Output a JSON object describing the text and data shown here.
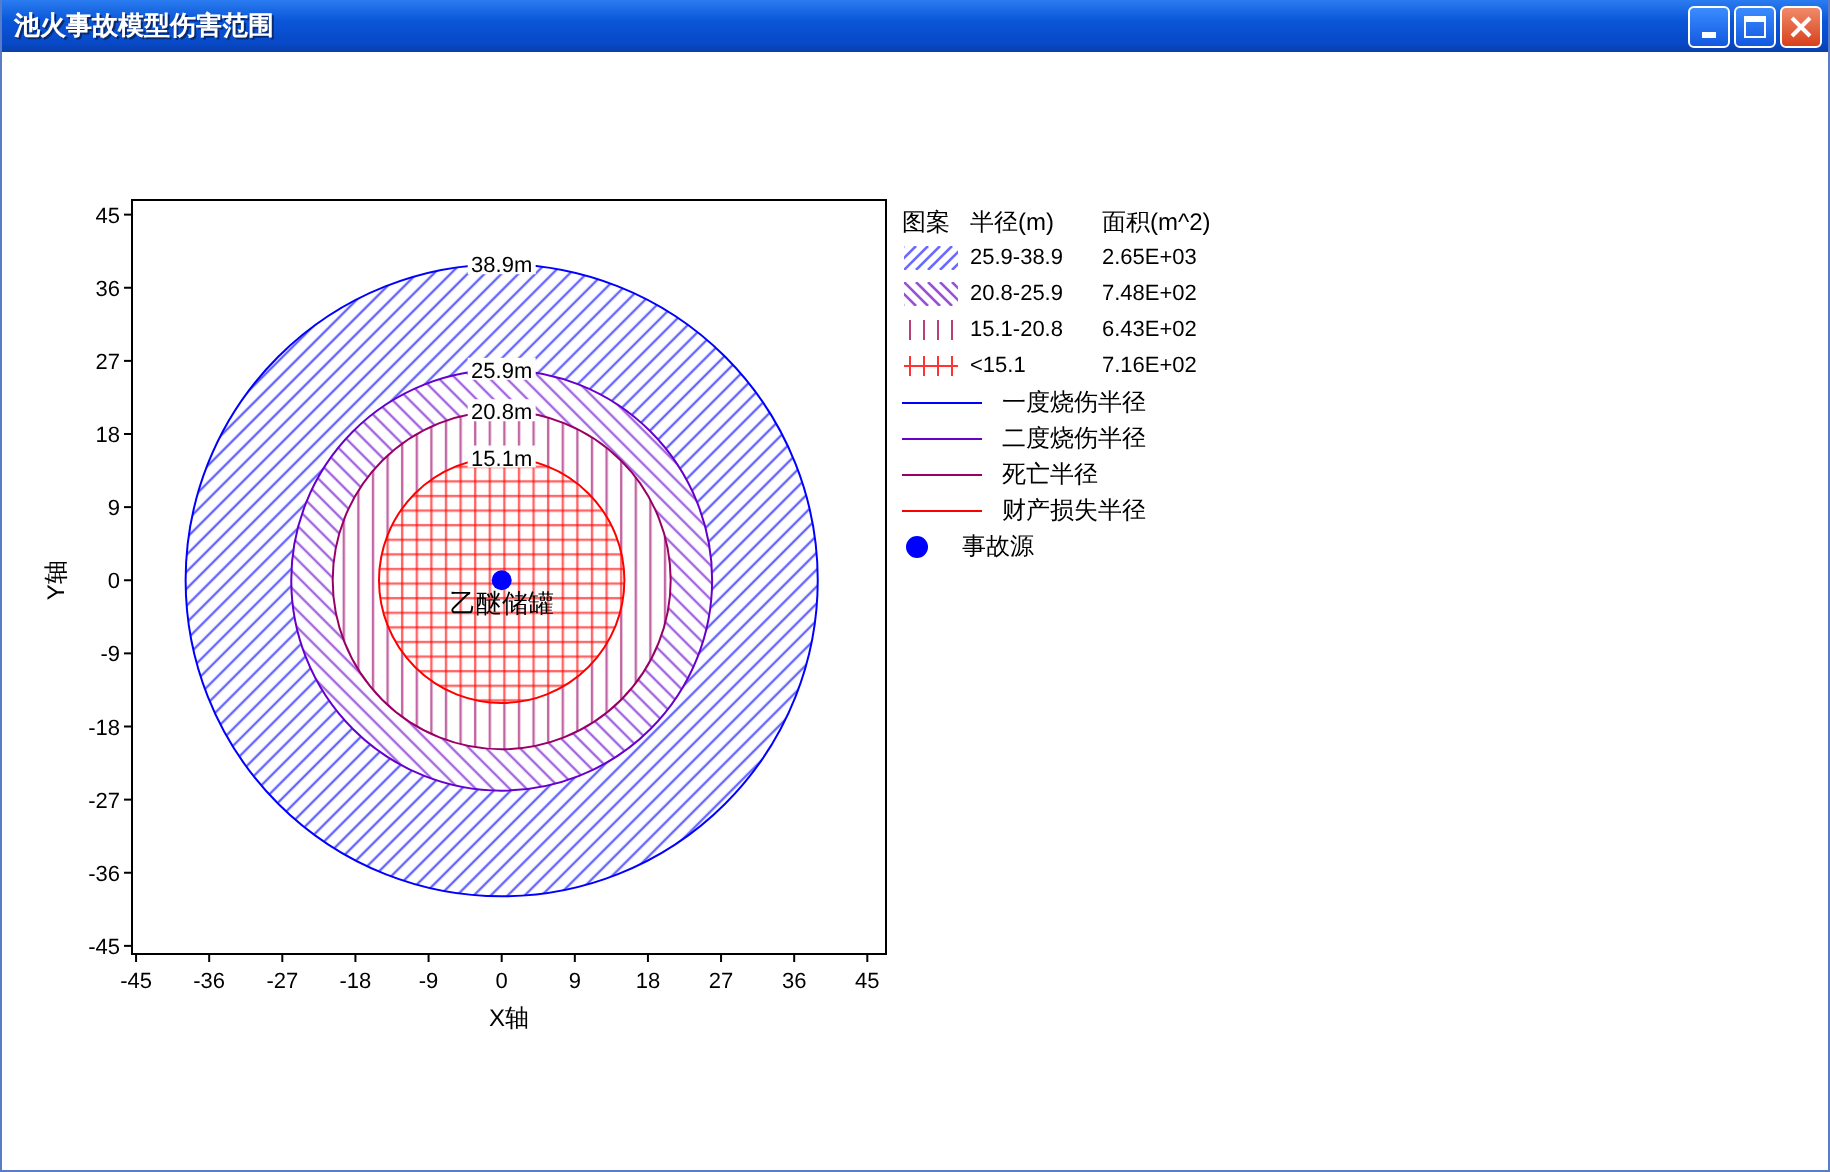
{
  "window": {
    "title": "池火事故模型伤害范围"
  },
  "plot": {
    "x_title": "X轴",
    "y_title": "Y轴",
    "x_ticks": [
      "-45",
      "-36",
      "-27",
      "-18",
      "-9",
      "0",
      "9",
      "18",
      "27",
      "36",
      "45"
    ],
    "y_ticks": [
      "45",
      "36",
      "27",
      "18",
      "9",
      "0",
      "-9",
      "-18",
      "-27",
      "-36",
      "-45"
    ],
    "zones": [
      {
        "kind": "slash",
        "label": "38.9m",
        "color": "#0000ff"
      },
      {
        "kind": "backslash",
        "label": "25.9m",
        "color": "#6600cc"
      },
      {
        "kind": "vertical",
        "label": "20.8m",
        "color": "#990066"
      },
      {
        "kind": "grid",
        "label": "15.1m",
        "color": "#ff0000"
      }
    ],
    "source": {
      "color": "#0000ff"
    },
    "tank_label": "乙醚储罐"
  },
  "legend": {
    "headers": [
      "图案",
      "半径(m)",
      "面积(m^2)"
    ],
    "items": [
      {
        "kind": "slash",
        "color": "#6a6aff",
        "range": "25.9-38.9",
        "area": "2.65E+03"
      },
      {
        "kind": "backslash",
        "color": "#9a4fd8",
        "range": "20.8-25.9",
        "area": "7.48E+02"
      },
      {
        "kind": "vertical",
        "color": "#b8407a",
        "range": "15.1-20.8",
        "area": "6.43E+02"
      },
      {
        "kind": "grid",
        "color": "#ff3333",
        "range": "<15.1",
        "area": "7.16E+02"
      },
      {
        "kind": "line",
        "color": "#0000ff",
        "label": "一度烧伤半径"
      },
      {
        "kind": "line",
        "color": "#6600cc",
        "label": "二度烧伤半径"
      },
      {
        "kind": "line",
        "color": "#990066",
        "label": "死亡半径"
      },
      {
        "kind": "line",
        "color": "#ff0000",
        "label": "财产损失半径"
      },
      {
        "kind": "dot",
        "color": "#0000ff",
        "label": "事故源"
      }
    ]
  }
}
